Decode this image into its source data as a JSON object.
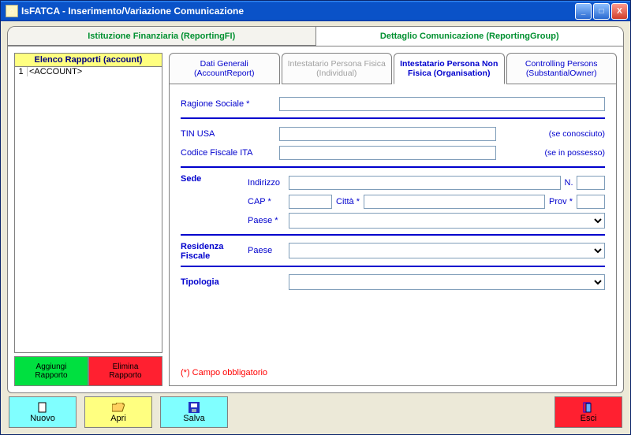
{
  "window": {
    "title": "IsFATCA - Inserimento/Variazione Comunicazione"
  },
  "topTabs": {
    "reportingFI": "Istituzione Finanziaria (ReportingFI)",
    "reportingGroup": "Dettaglio Comunicazione (ReportingGroup)"
  },
  "leftPanel": {
    "header": "Elenco Rapporti (account)",
    "rows": [
      {
        "n": "1",
        "v": "<ACCOUNT>"
      }
    ],
    "addBtn": "Aggiungi\nRapporto",
    "delBtn": "Elimina\nRapporto"
  },
  "subTabs": {
    "t1": "Dati Generali (AccountReport)",
    "t2": "Intestatario Persona Fisica (Individual)",
    "t3": "Intestatario Persona Non Fisica (Organisation)",
    "t4": "Controlling Persons (SubstantialOwner)"
  },
  "form": {
    "ragioneSociale": "Ragione Sociale *",
    "tinUsa": "TIN USA",
    "tinUsaHint": "(se conosciuto)",
    "codFisc": "Codice Fiscale ITA",
    "codFiscHint": "(se in possesso)",
    "sede": "Sede",
    "indirizzo": "Indirizzo",
    "n": "N.",
    "cap": "CAP *",
    "citta": "Città *",
    "prov": "Prov *",
    "paese": "Paese *",
    "residenza": "Residenza Fiscale",
    "paese2": "Paese",
    "tipologia": "Tipologia",
    "footnote": "(*) Campo obbligatorio"
  },
  "bottom": {
    "nuovo": "Nuovo",
    "apri": "Apri",
    "salva": "Salva",
    "esci": "Esci"
  }
}
